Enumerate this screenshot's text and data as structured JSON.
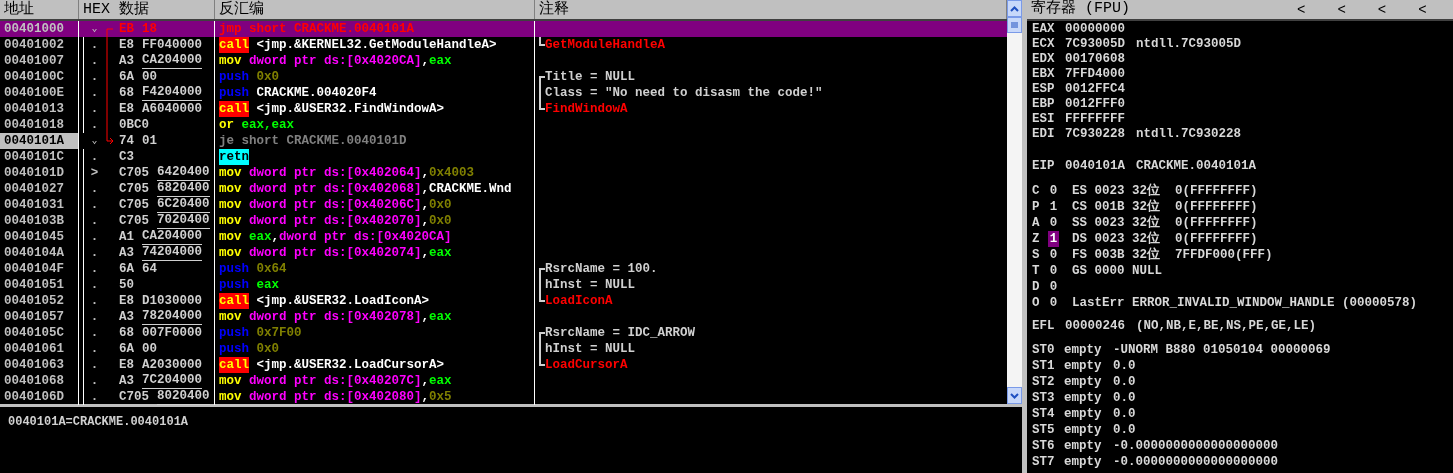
{
  "disassembly": {
    "columns": [
      "地址",
      "HEX 数据",
      "反汇编",
      "注释"
    ],
    "rows": [
      {
        "address": "00401000",
        "selected": true,
        "current": false,
        "marker": "⌄",
        "jump_source": true,
        "opcode": "EB",
        "operand": "18",
        "underlined": false,
        "disasm": [
          {
            "text": "jmp short CRACKME.0040101A",
            "kind": "jump"
          }
        ]
      },
      {
        "address": "00401002",
        "selected": false,
        "current": false,
        "marker": ".",
        "opcode": "E8",
        "operand": "FF040000",
        "underlined": false,
        "disasm": [
          {
            "text": "call",
            "kind": "call"
          },
          {
            "text": " <jmp.&KERNEL32.GetModuleHandleA>",
            "kind": "text"
          }
        ],
        "comment": {
          "text": "GetModuleHandleA",
          "kind": "api"
        }
      },
      {
        "address": "00401007",
        "selected": false,
        "current": false,
        "marker": ".",
        "opcode": "A3",
        "operand": "CA204000",
        "underlined": true,
        "disasm": [
          {
            "text": "mov",
            "kind": "mnemonic"
          },
          {
            "text": " dword ptr ds:[0x4020CA]",
            "kind": "memory"
          },
          {
            "text": ",",
            "kind": "text"
          },
          {
            "text": "eax",
            "kind": "register"
          }
        ]
      },
      {
        "address": "0040100C",
        "selected": false,
        "current": false,
        "marker": ".",
        "opcode": "6A",
        "operand": "00",
        "underlined": false,
        "disasm": [
          {
            "text": "push",
            "kind": "push"
          },
          {
            "text": " 0x0",
            "kind": "constant"
          }
        ],
        "comment": {
          "text": "Title = NULL",
          "kind": "first_arg"
        }
      },
      {
        "address": "0040100E",
        "selected": false,
        "current": false,
        "marker": ".",
        "opcode": "68",
        "operand": "F4204000",
        "underlined": true,
        "disasm": [
          {
            "text": "push",
            "kind": "push"
          },
          {
            "text": " CRACKME.004020F4",
            "kind": "text"
          }
        ],
        "comment": {
          "text": "Class = \"No need to disasm the code!\"",
          "kind": "arg"
        }
      },
      {
        "address": "00401013",
        "selected": false,
        "current": false,
        "marker": ".",
        "opcode": "E8",
        "operand": "A6040000",
        "underlined": false,
        "disasm": [
          {
            "text": "call",
            "kind": "call"
          },
          {
            "text": " <jmp.&USER32.FindWindowA>",
            "kind": "text"
          }
        ],
        "comment": {
          "text": "FindWindowA",
          "kind": "api"
        }
      },
      {
        "address": "00401018",
        "selected": false,
        "current": false,
        "marker": ".",
        "opcode": "0BC0",
        "disasm": [
          {
            "text": "or",
            "kind": "mnemonic"
          },
          {
            "text": " eax,eax",
            "kind": "register"
          }
        ]
      },
      {
        "address": "0040101A",
        "selected": false,
        "current": true,
        "marker": "⌄",
        "jump_target": true,
        "opcode": "74",
        "operand": "01",
        "underlined": false,
        "disasm": [
          {
            "text": "je short CRACKME.0040101D",
            "kind": "conditional_jump"
          }
        ]
      },
      {
        "address": "0040101C",
        "selected": false,
        "current": false,
        "marker": ".",
        "opcode": "C3",
        "disasm": [
          {
            "text": "retn",
            "kind": "return"
          }
        ]
      },
      {
        "address": "0040101D",
        "selected": false,
        "current": false,
        "marker": ">",
        "opcode": "C705",
        "operand": "6420400",
        "underlined": true,
        "disasm": [
          {
            "text": "mov",
            "kind": "mnemonic"
          },
          {
            "text": " dword ptr ds:[0x402064]",
            "kind": "memory"
          },
          {
            "text": ",",
            "kind": "text"
          },
          {
            "text": "0x4003",
            "kind": "constant"
          }
        ]
      },
      {
        "address": "00401027",
        "selected": false,
        "current": false,
        "marker": ".",
        "opcode": "C705",
        "operand": "6820400",
        "underlined": true,
        "disasm": [
          {
            "text": "mov",
            "kind": "mnemonic"
          },
          {
            "text": " dword ptr ds:[0x402068]",
            "kind": "memory"
          },
          {
            "text": ",CRACKME.Wnd",
            "kind": "text"
          }
        ]
      },
      {
        "address": "00401031",
        "selected": false,
        "current": false,
        "marker": ".",
        "opcode": "C705",
        "operand": "6C20400",
        "underlined": true,
        "disasm": [
          {
            "text": "mov",
            "kind": "mnemonic"
          },
          {
            "text": " dword ptr ds:[0x40206C]",
            "kind": "memory"
          },
          {
            "text": ",",
            "kind": "text"
          },
          {
            "text": "0x0",
            "kind": "constant"
          }
        ]
      },
      {
        "address": "0040103B",
        "selected": false,
        "current": false,
        "marker": ".",
        "opcode": "C705",
        "operand": "7020400",
        "underlined": true,
        "disasm": [
          {
            "text": "mov",
            "kind": "mnemonic"
          },
          {
            "text": " dword ptr ds:[0x402070]",
            "kind": "memory"
          },
          {
            "text": ",",
            "kind": "text"
          },
          {
            "text": "0x0",
            "kind": "constant"
          }
        ]
      },
      {
        "address": "00401045",
        "selected": false,
        "current": false,
        "marker": ".",
        "opcode": "A1",
        "operand": "CA204000",
        "underlined": true,
        "disasm": [
          {
            "text": "mov",
            "kind": "mnemonic"
          },
          {
            "text": " eax",
            "kind": "register"
          },
          {
            "text": ",",
            "kind": "text"
          },
          {
            "text": "dword ptr ds:[0x4020CA]",
            "kind": "memory"
          }
        ]
      },
      {
        "address": "0040104A",
        "selected": false,
        "current": false,
        "marker": ".",
        "opcode": "A3",
        "operand": "74204000",
        "underlined": true,
        "disasm": [
          {
            "text": "mov",
            "kind": "mnemonic"
          },
          {
            "text": " dword ptr ds:[0x402074]",
            "kind": "memory"
          },
          {
            "text": ",",
            "kind": "text"
          },
          {
            "text": "eax",
            "kind": "register"
          }
        ]
      },
      {
        "address": "0040104F",
        "selected": false,
        "current": false,
        "marker": ".",
        "opcode": "6A",
        "operand": "64",
        "underlined": false,
        "disasm": [
          {
            "text": "push",
            "kind": "push"
          },
          {
            "text": " 0x64",
            "kind": "constant"
          }
        ],
        "comment": {
          "text": "RsrcName = 100.",
          "kind": "first_arg"
        }
      },
      {
        "address": "00401051",
        "selected": false,
        "current": false,
        "marker": ".",
        "opcode": "50",
        "disasm": [
          {
            "text": "push",
            "kind": "push"
          },
          {
            "text": " eax",
            "kind": "register"
          }
        ],
        "comment": {
          "text": "hInst = NULL",
          "kind": "arg"
        }
      },
      {
        "address": "00401052",
        "selected": false,
        "current": false,
        "marker": ".",
        "opcode": "E8",
        "operand": "D1030000",
        "underlined": false,
        "disasm": [
          {
            "text": "call",
            "kind": "call"
          },
          {
            "text": " <jmp.&USER32.LoadIconA>",
            "kind": "text"
          }
        ],
        "comment": {
          "text": "LoadIconA",
          "kind": "api"
        }
      },
      {
        "address": "00401057",
        "selected": false,
        "current": false,
        "marker": ".",
        "opcode": "A3",
        "operand": "78204000",
        "underlined": true,
        "disasm": [
          {
            "text": "mov",
            "kind": "mnemonic"
          },
          {
            "text": " dword ptr ds:[0x402078]",
            "kind": "memory"
          },
          {
            "text": ",",
            "kind": "text"
          },
          {
            "text": "eax",
            "kind": "register"
          }
        ]
      },
      {
        "address": "0040105C",
        "selected": false,
        "current": false,
        "marker": ".",
        "opcode": "68",
        "operand": "007F0000",
        "underlined": false,
        "disasm": [
          {
            "text": "push",
            "kind": "push"
          },
          {
            "text": " 0x7F00",
            "kind": "constant"
          }
        ],
        "comment": {
          "text": "RsrcName = IDC_ARROW",
          "kind": "first_arg"
        }
      },
      {
        "address": "00401061",
        "selected": false,
        "current": false,
        "marker": ".",
        "opcode": "6A",
        "operand": "00",
        "underlined": false,
        "disasm": [
          {
            "text": "push",
            "kind": "push"
          },
          {
            "text": " 0x0",
            "kind": "constant"
          }
        ],
        "comment": {
          "text": "hInst = NULL",
          "kind": "arg"
        }
      },
      {
        "address": "00401063",
        "selected": false,
        "current": false,
        "marker": ".",
        "opcode": "E8",
        "operand": "A2030000",
        "underlined": false,
        "disasm": [
          {
            "text": "call",
            "kind": "call"
          },
          {
            "text": " <jmp.&USER32.LoadCursorA>",
            "kind": "text"
          }
        ],
        "comment": {
          "text": "LoadCursorA",
          "kind": "api"
        }
      },
      {
        "address": "00401068",
        "selected": false,
        "current": false,
        "marker": ".",
        "opcode": "A3",
        "operand": "7C204000",
        "underlined": true,
        "disasm": [
          {
            "text": "mov",
            "kind": "mnemonic"
          },
          {
            "text": " dword ptr ds:[0x40207C]",
            "kind": "memory"
          },
          {
            "text": ",",
            "kind": "text"
          },
          {
            "text": "eax",
            "kind": "register"
          }
        ]
      },
      {
        "address": "0040106D",
        "selected": false,
        "current": false,
        "marker": ".",
        "opcode": "C705",
        "operand": "8020400",
        "underlined": true,
        "disasm": [
          {
            "text": "mov",
            "kind": "mnemonic"
          },
          {
            "text": " dword ptr ds:[0x402080]",
            "kind": "memory"
          },
          {
            "text": ",",
            "kind": "text"
          },
          {
            "text": "0x5",
            "kind": "constant"
          }
        ]
      }
    ]
  },
  "info_pane": {
    "text": "0040101A=CRACKME.0040101A"
  },
  "registers": {
    "title": "寄存器 (FPU)",
    "buttons": [
      "<",
      "<",
      "<",
      "<"
    ],
    "general": [
      {
        "name": "EAX",
        "value": "00000000"
      },
      {
        "name": "ECX",
        "value": "7C93005D",
        "comment": "ntdll.7C93005D"
      },
      {
        "name": "EDX",
        "value": "00170608"
      },
      {
        "name": "EBX",
        "value": "7FFD4000"
      },
      {
        "name": "ESP",
        "value": "0012FFC4"
      },
      {
        "name": "EBP",
        "value": "0012FFF0"
      },
      {
        "name": "ESI",
        "value": "FFFFFFFF"
      },
      {
        "name": "EDI",
        "value": "7C930228",
        "comment": "ntdll.7C930228"
      }
    ],
    "eip": {
      "name": "EIP",
      "value": "0040101A",
      "comment": "CRACKME.0040101A"
    },
    "flags": [
      {
        "name": "C",
        "value": "0",
        "changed": false,
        "detail": "ES 0023 32位  0(FFFFFFFF)"
      },
      {
        "name": "P",
        "value": "1",
        "changed": false,
        "detail": "CS 001B 32位  0(FFFFFFFF)"
      },
      {
        "name": "A",
        "value": "0",
        "changed": false,
        "detail": "SS 0023 32位  0(FFFFFFFF)"
      },
      {
        "name": "Z",
        "value": "1",
        "changed": true,
        "detail": "DS 0023 32位  0(FFFFFFFF)"
      },
      {
        "name": "S",
        "value": "0",
        "changed": false,
        "detail": "FS 003B 32位  7FFDF000(FFF)"
      },
      {
        "name": "T",
        "value": "0",
        "changed": false,
        "detail": "GS 0000 NULL"
      },
      {
        "name": "D",
        "value": "0",
        "changed": false
      },
      {
        "name": "O",
        "value": "0",
        "changed": false,
        "detail": "LastErr ERROR_INVALID_WINDOW_HANDLE (00000578)"
      }
    ],
    "efl": {
      "name": "EFL",
      "value": "00000246",
      "comment": "(NO,NB,E,BE,NS,PE,GE,LE)"
    },
    "fpu": [
      {
        "name": "ST0",
        "tag": "empty",
        "value": "-UNORM B880 01050104 00000069"
      },
      {
        "name": "ST1",
        "tag": "empty",
        "value": "0.0"
      },
      {
        "name": "ST2",
        "tag": "empty",
        "value": "0.0"
      },
      {
        "name": "ST3",
        "tag": "empty",
        "value": "0.0"
      },
      {
        "name": "ST4",
        "tag": "empty",
        "value": "0.0"
      },
      {
        "name": "ST5",
        "tag": "empty",
        "value": "0.0"
      },
      {
        "name": "ST6",
        "tag": "empty",
        "value": "-0.0000000000000000000"
      },
      {
        "name": "ST7",
        "tag": "empty",
        "value": "-0.0000000000000000000"
      }
    ]
  }
}
